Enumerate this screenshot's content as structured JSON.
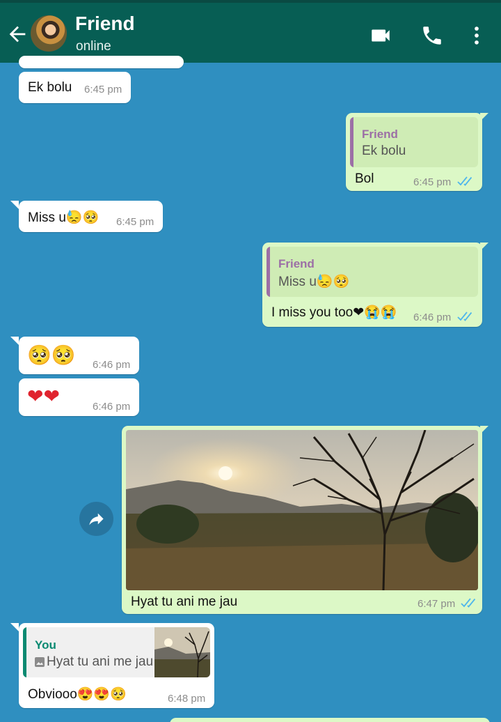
{
  "header": {
    "contact_name": "Friend",
    "status": "online",
    "icons": [
      "back-arrow-icon",
      "video-call-icon",
      "phone-icon",
      "more-options-icon"
    ]
  },
  "messages": [
    {
      "dir": "in",
      "text": "Ek bolu",
      "time": "6:45 pm"
    },
    {
      "dir": "out",
      "quote_name": "Friend",
      "quote_text": "Ek bolu",
      "text": "Bol",
      "time": "6:45 pm"
    },
    {
      "dir": "in",
      "text": "Miss u😓🥺",
      "time": "6:45 pm"
    },
    {
      "dir": "out",
      "quote_name": "Friend",
      "quote_text": "Miss u😓🥺",
      "text": "I miss you too❤😭😭",
      "time": "6:46 pm"
    },
    {
      "dir": "in",
      "text": "🥺🥺",
      "time": "6:46 pm"
    },
    {
      "dir": "in",
      "text": "❤❤",
      "time": "6:46 pm"
    },
    {
      "dir": "out",
      "image": "sunset-landscape-photo",
      "text": "Hyat tu ani me jau",
      "time": "6:47 pm"
    },
    {
      "dir": "in",
      "quote_name": "You",
      "quote_text": "Hyat tu ani me jau",
      "text": "Obviooo😍😍🥺",
      "time": "6:48 pm"
    }
  ],
  "colors": {
    "header": "#075e54",
    "background": "#2f8fc0",
    "incoming": "#ffffff",
    "outgoing": "#dcf8c6",
    "quote_friend": "#9c6fa6",
    "quote_you": "#0a8a72",
    "read_tick": "#4fb6ec"
  }
}
